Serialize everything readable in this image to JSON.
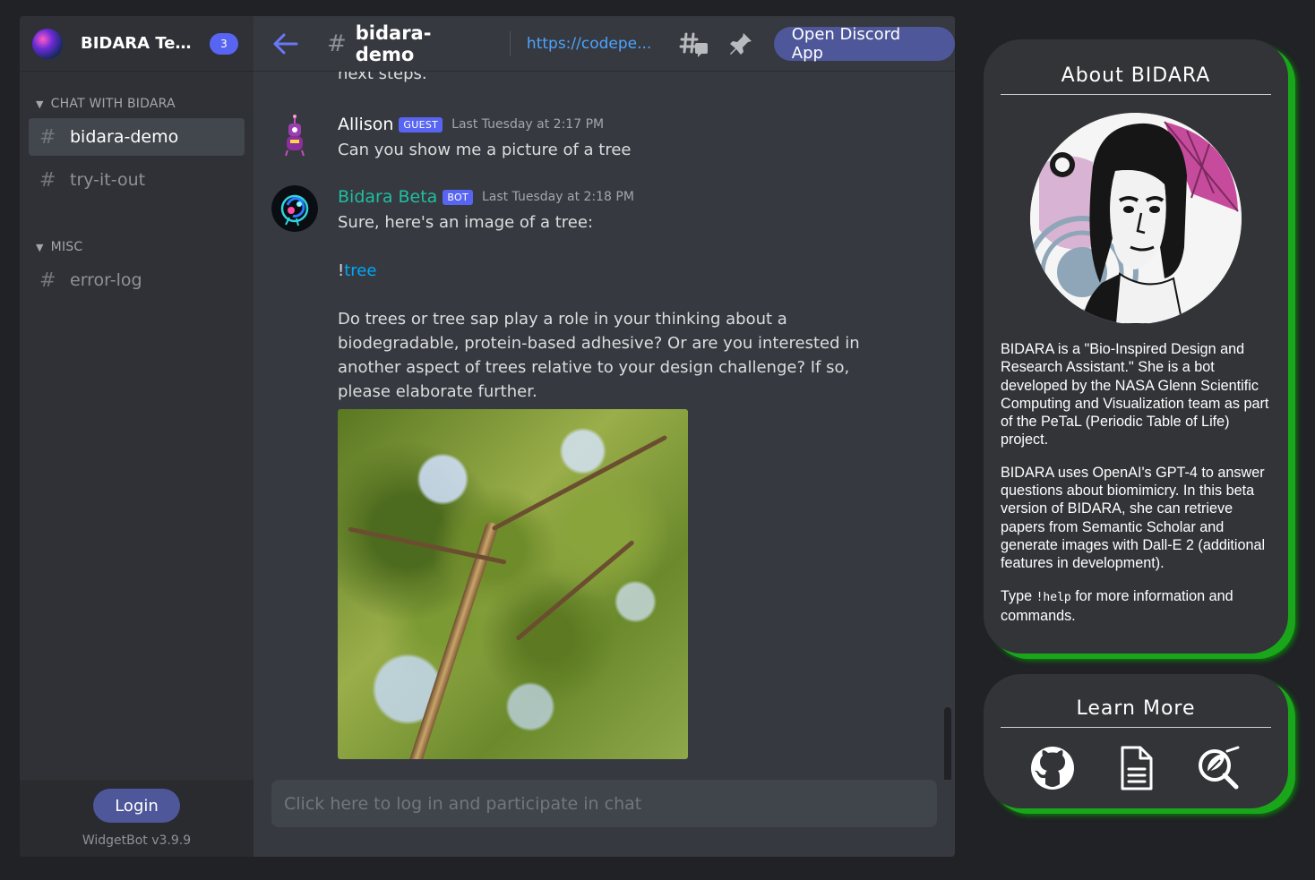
{
  "widget": {
    "guild": {
      "name": "BIDARA Tes...",
      "badge": "3"
    },
    "categories": [
      {
        "name": "CHAT WITH BIDARA",
        "channels": [
          "bidara-demo",
          "try-it-out"
        ]
      },
      {
        "name": "MISC",
        "channels": [
          "error-log"
        ]
      }
    ],
    "active_channel": "bidara-demo",
    "login_label": "Login",
    "version": "WidgetBot v3.9.9",
    "topbar": {
      "channel": "bidara-demo",
      "topic": "https://codepe...",
      "open_label": "Open Discord App"
    },
    "previous_text": "next steps.",
    "messages": [
      {
        "author": "Allison",
        "tag": "GUEST",
        "timestamp": "Last Tuesday at 2:17 PM",
        "text": "Can you show me a picture of a tree"
      },
      {
        "author": "Bidara Beta",
        "tag": "BOT",
        "timestamp": "Last Tuesday at 2:18 PM",
        "text": "Sure, here's an image of a tree:",
        "link_prefix": "!",
        "link": "tree",
        "text2": "Do trees or tree sap play a role in your thinking about a biodegradable, protein-based adhesive? Or are you interested in another aspect of trees relative to your design challenge? If so, please elaborate further."
      }
    ],
    "input_placeholder": "Click here to log in and participate in chat"
  },
  "about": {
    "title": "About BIDARA",
    "p1": "BIDARA is a \"Bio-Inspired Design and Research Assistant.\" She is a bot developed by the NASA Glenn Scientific Computing and Visualization team as part of the PeTaL (Periodic Table of Life) project.",
    "p2": "BIDARA uses OpenAI's GPT-4 to answer questions about biomimicry. In this beta version of BIDARA, she can retrieve papers from Semantic Scholar and generate images with Dall-E 2 (additional features in development).",
    "p3_before": "Type ",
    "p3_code": "!help",
    "p3_after": " for more information and commands."
  },
  "learn": {
    "title": "Learn More",
    "icons": [
      "github-icon",
      "document-icon",
      "leaf-search-icon"
    ]
  },
  "colors": {
    "accent": "#5865f2",
    "button": "#4e5799",
    "bot_name": "#1fbfa3",
    "card_glow": "#1aa61a"
  }
}
